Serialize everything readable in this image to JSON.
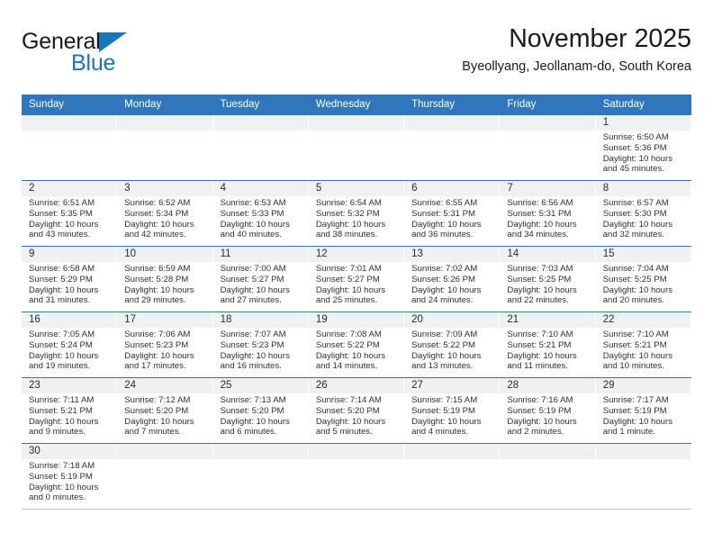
{
  "brand": {
    "name_part1": "General",
    "name_part2": "Blue",
    "accent_color": "#1b75bb"
  },
  "header": {
    "title": "November 2025",
    "subtitle": "Byeollyang, Jeollanam-do, South Korea"
  },
  "theme": {
    "header_blue": "#2f76bc",
    "daynum_band": "#f1f1f1",
    "text": "#303030"
  },
  "calendar": {
    "weekday_headers": [
      "Sunday",
      "Monday",
      "Tuesday",
      "Wednesday",
      "Thursday",
      "Friday",
      "Saturday"
    ],
    "weeks": [
      [
        {
          "day": "",
          "empty": true,
          "sunrise": "",
          "sunset": "",
          "daylight_line1": "",
          "daylight_line2": ""
        },
        {
          "day": "",
          "empty": true,
          "sunrise": "",
          "sunset": "",
          "daylight_line1": "",
          "daylight_line2": ""
        },
        {
          "day": "",
          "empty": true,
          "sunrise": "",
          "sunset": "",
          "daylight_line1": "",
          "daylight_line2": ""
        },
        {
          "day": "",
          "empty": true,
          "sunrise": "",
          "sunset": "",
          "daylight_line1": "",
          "daylight_line2": ""
        },
        {
          "day": "",
          "empty": true,
          "sunrise": "",
          "sunset": "",
          "daylight_line1": "",
          "daylight_line2": ""
        },
        {
          "day": "",
          "empty": true,
          "sunrise": "",
          "sunset": "",
          "daylight_line1": "",
          "daylight_line2": ""
        },
        {
          "day": "1",
          "empty": false,
          "sunrise": "Sunrise: 6:50 AM",
          "sunset": "Sunset: 5:36 PM",
          "daylight_line1": "Daylight: 10 hours",
          "daylight_line2": "and 45 minutes."
        }
      ],
      [
        {
          "day": "2",
          "empty": false,
          "sunrise": "Sunrise: 6:51 AM",
          "sunset": "Sunset: 5:35 PM",
          "daylight_line1": "Daylight: 10 hours",
          "daylight_line2": "and 43 minutes."
        },
        {
          "day": "3",
          "empty": false,
          "sunrise": "Sunrise: 6:52 AM",
          "sunset": "Sunset: 5:34 PM",
          "daylight_line1": "Daylight: 10 hours",
          "daylight_line2": "and 42 minutes."
        },
        {
          "day": "4",
          "empty": false,
          "sunrise": "Sunrise: 6:53 AM",
          "sunset": "Sunset: 5:33 PM",
          "daylight_line1": "Daylight: 10 hours",
          "daylight_line2": "and 40 minutes."
        },
        {
          "day": "5",
          "empty": false,
          "sunrise": "Sunrise: 6:54 AM",
          "sunset": "Sunset: 5:32 PM",
          "daylight_line1": "Daylight: 10 hours",
          "daylight_line2": "and 38 minutes."
        },
        {
          "day": "6",
          "empty": false,
          "sunrise": "Sunrise: 6:55 AM",
          "sunset": "Sunset: 5:31 PM",
          "daylight_line1": "Daylight: 10 hours",
          "daylight_line2": "and 36 minutes."
        },
        {
          "day": "7",
          "empty": false,
          "sunrise": "Sunrise: 6:56 AM",
          "sunset": "Sunset: 5:31 PM",
          "daylight_line1": "Daylight: 10 hours",
          "daylight_line2": "and 34 minutes."
        },
        {
          "day": "8",
          "empty": false,
          "sunrise": "Sunrise: 6:57 AM",
          "sunset": "Sunset: 5:30 PM",
          "daylight_line1": "Daylight: 10 hours",
          "daylight_line2": "and 32 minutes."
        }
      ],
      [
        {
          "day": "9",
          "empty": false,
          "sunrise": "Sunrise: 6:58 AM",
          "sunset": "Sunset: 5:29 PM",
          "daylight_line1": "Daylight: 10 hours",
          "daylight_line2": "and 31 minutes."
        },
        {
          "day": "10",
          "empty": false,
          "sunrise": "Sunrise: 6:59 AM",
          "sunset": "Sunset: 5:28 PM",
          "daylight_line1": "Daylight: 10 hours",
          "daylight_line2": "and 29 minutes."
        },
        {
          "day": "11",
          "empty": false,
          "sunrise": "Sunrise: 7:00 AM",
          "sunset": "Sunset: 5:27 PM",
          "daylight_line1": "Daylight: 10 hours",
          "daylight_line2": "and 27 minutes."
        },
        {
          "day": "12",
          "empty": false,
          "sunrise": "Sunrise: 7:01 AM",
          "sunset": "Sunset: 5:27 PM",
          "daylight_line1": "Daylight: 10 hours",
          "daylight_line2": "and 25 minutes."
        },
        {
          "day": "13",
          "empty": false,
          "sunrise": "Sunrise: 7:02 AM",
          "sunset": "Sunset: 5:26 PM",
          "daylight_line1": "Daylight: 10 hours",
          "daylight_line2": "and 24 minutes."
        },
        {
          "day": "14",
          "empty": false,
          "sunrise": "Sunrise: 7:03 AM",
          "sunset": "Sunset: 5:25 PM",
          "daylight_line1": "Daylight: 10 hours",
          "daylight_line2": "and 22 minutes."
        },
        {
          "day": "15",
          "empty": false,
          "sunrise": "Sunrise: 7:04 AM",
          "sunset": "Sunset: 5:25 PM",
          "daylight_line1": "Daylight: 10 hours",
          "daylight_line2": "and 20 minutes."
        }
      ],
      [
        {
          "day": "16",
          "empty": false,
          "sunrise": "Sunrise: 7:05 AM",
          "sunset": "Sunset: 5:24 PM",
          "daylight_line1": "Daylight: 10 hours",
          "daylight_line2": "and 19 minutes."
        },
        {
          "day": "17",
          "empty": false,
          "sunrise": "Sunrise: 7:06 AM",
          "sunset": "Sunset: 5:23 PM",
          "daylight_line1": "Daylight: 10 hours",
          "daylight_line2": "and 17 minutes."
        },
        {
          "day": "18",
          "empty": false,
          "sunrise": "Sunrise: 7:07 AM",
          "sunset": "Sunset: 5:23 PM",
          "daylight_line1": "Daylight: 10 hours",
          "daylight_line2": "and 16 minutes."
        },
        {
          "day": "19",
          "empty": false,
          "sunrise": "Sunrise: 7:08 AM",
          "sunset": "Sunset: 5:22 PM",
          "daylight_line1": "Daylight: 10 hours",
          "daylight_line2": "and 14 minutes."
        },
        {
          "day": "20",
          "empty": false,
          "sunrise": "Sunrise: 7:09 AM",
          "sunset": "Sunset: 5:22 PM",
          "daylight_line1": "Daylight: 10 hours",
          "daylight_line2": "and 13 minutes."
        },
        {
          "day": "21",
          "empty": false,
          "sunrise": "Sunrise: 7:10 AM",
          "sunset": "Sunset: 5:21 PM",
          "daylight_line1": "Daylight: 10 hours",
          "daylight_line2": "and 11 minutes."
        },
        {
          "day": "22",
          "empty": false,
          "sunrise": "Sunrise: 7:10 AM",
          "sunset": "Sunset: 5:21 PM",
          "daylight_line1": "Daylight: 10 hours",
          "daylight_line2": "and 10 minutes."
        }
      ],
      [
        {
          "day": "23",
          "empty": false,
          "sunrise": "Sunrise: 7:11 AM",
          "sunset": "Sunset: 5:21 PM",
          "daylight_line1": "Daylight: 10 hours",
          "daylight_line2": "and 9 minutes."
        },
        {
          "day": "24",
          "empty": false,
          "sunrise": "Sunrise: 7:12 AM",
          "sunset": "Sunset: 5:20 PM",
          "daylight_line1": "Daylight: 10 hours",
          "daylight_line2": "and 7 minutes."
        },
        {
          "day": "25",
          "empty": false,
          "sunrise": "Sunrise: 7:13 AM",
          "sunset": "Sunset: 5:20 PM",
          "daylight_line1": "Daylight: 10 hours",
          "daylight_line2": "and 6 minutes."
        },
        {
          "day": "26",
          "empty": false,
          "sunrise": "Sunrise: 7:14 AM",
          "sunset": "Sunset: 5:20 PM",
          "daylight_line1": "Daylight: 10 hours",
          "daylight_line2": "and 5 minutes."
        },
        {
          "day": "27",
          "empty": false,
          "sunrise": "Sunrise: 7:15 AM",
          "sunset": "Sunset: 5:19 PM",
          "daylight_line1": "Daylight: 10 hours",
          "daylight_line2": "and 4 minutes."
        },
        {
          "day": "28",
          "empty": false,
          "sunrise": "Sunrise: 7:16 AM",
          "sunset": "Sunset: 5:19 PM",
          "daylight_line1": "Daylight: 10 hours",
          "daylight_line2": "and 2 minutes."
        },
        {
          "day": "29",
          "empty": false,
          "sunrise": "Sunrise: 7:17 AM",
          "sunset": "Sunset: 5:19 PM",
          "daylight_line1": "Daylight: 10 hours",
          "daylight_line2": "and 1 minute."
        }
      ],
      [
        {
          "day": "30",
          "empty": false,
          "sunrise": "Sunrise: 7:18 AM",
          "sunset": "Sunset: 5:19 PM",
          "daylight_line1": "Daylight: 10 hours",
          "daylight_line2": "and 0 minutes."
        },
        {
          "day": "",
          "empty": true,
          "sunrise": "",
          "sunset": "",
          "daylight_line1": "",
          "daylight_line2": ""
        },
        {
          "day": "",
          "empty": true,
          "sunrise": "",
          "sunset": "",
          "daylight_line1": "",
          "daylight_line2": ""
        },
        {
          "day": "",
          "empty": true,
          "sunrise": "",
          "sunset": "",
          "daylight_line1": "",
          "daylight_line2": ""
        },
        {
          "day": "",
          "empty": true,
          "sunrise": "",
          "sunset": "",
          "daylight_line1": "",
          "daylight_line2": ""
        },
        {
          "day": "",
          "empty": true,
          "sunrise": "",
          "sunset": "",
          "daylight_line1": "",
          "daylight_line2": ""
        },
        {
          "day": "",
          "empty": true,
          "sunrise": "",
          "sunset": "",
          "daylight_line1": "",
          "daylight_line2": ""
        }
      ]
    ]
  }
}
